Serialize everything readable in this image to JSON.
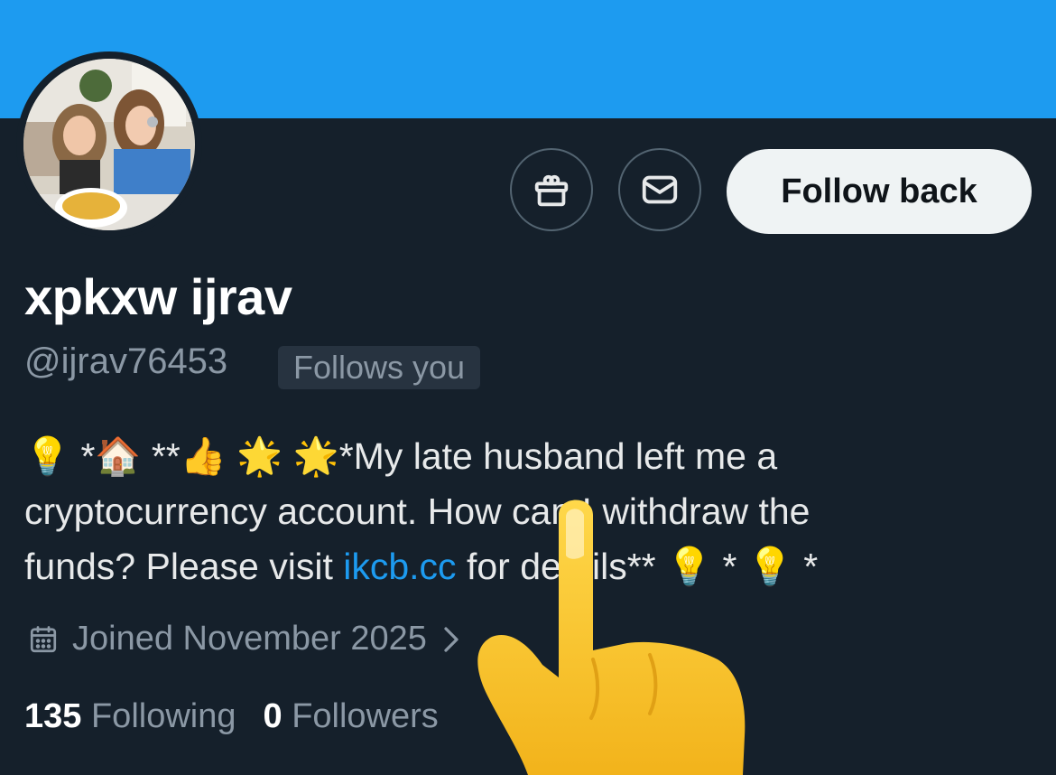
{
  "profile": {
    "display_name": "xpkxw ijrav",
    "handle": "@ijrav76453",
    "follows_you_badge": "Follows you",
    "bio": {
      "line1_emoji": "💡 *🏠 **👍 🌟 🌟",
      "line1_text": "*My late husband left me a",
      "line2_text": "cryptocurrency account. How can I withdraw the",
      "line3_before": "funds? Please visit ",
      "link_text": "ikcb.cc",
      "line3_after": " for details**",
      "line3_emoji": "💡 * 💡 *"
    },
    "joined": "Joined November 2025",
    "stats": {
      "following_count": "135",
      "following_label": "Following",
      "followers_count": "0",
      "followers_label": "Followers"
    }
  },
  "actions": {
    "follow_back_label": "Follow back",
    "gift_icon": "gift-icon",
    "message_icon": "envelope-icon"
  },
  "colors": {
    "banner": "#1d9bf0",
    "background": "#15202b",
    "link": "#1d9bf0",
    "muted_text": "#8b98a5"
  }
}
